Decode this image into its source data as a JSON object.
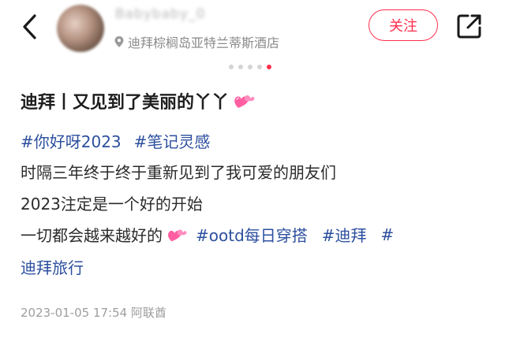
{
  "header": {
    "username": "Babybaby_0",
    "location": "迪拜棕榈岛亚特兰蒂斯酒店",
    "follow_label": "关注"
  },
  "carousel": {
    "total": 5,
    "active": 5
  },
  "post": {
    "title": "迪拜丨又见到了美丽的丫丫",
    "tags_line1": [
      "#你好呀2023",
      "#笔记灵感"
    ],
    "line2": "时隔三年终于终于重新见到了我可爱的朋友们",
    "line3": "2023注定是一个好的开始",
    "line4_text": "一切都会越来越好的",
    "line4_tags": [
      "#ootd每日穿搭",
      "#迪拜",
      "#"
    ],
    "line5_tag": "迪拜旅行",
    "timestamp": "2023-01-05 17:54 阿联酋"
  },
  "colors": {
    "accent": "#ff2e4d",
    "tag": "#2c4f9e",
    "heart": "#ff5fa2"
  },
  "icons": [
    "back-arrow-icon",
    "location-pin-icon",
    "share-icon",
    "heart-emoji-icon"
  ]
}
